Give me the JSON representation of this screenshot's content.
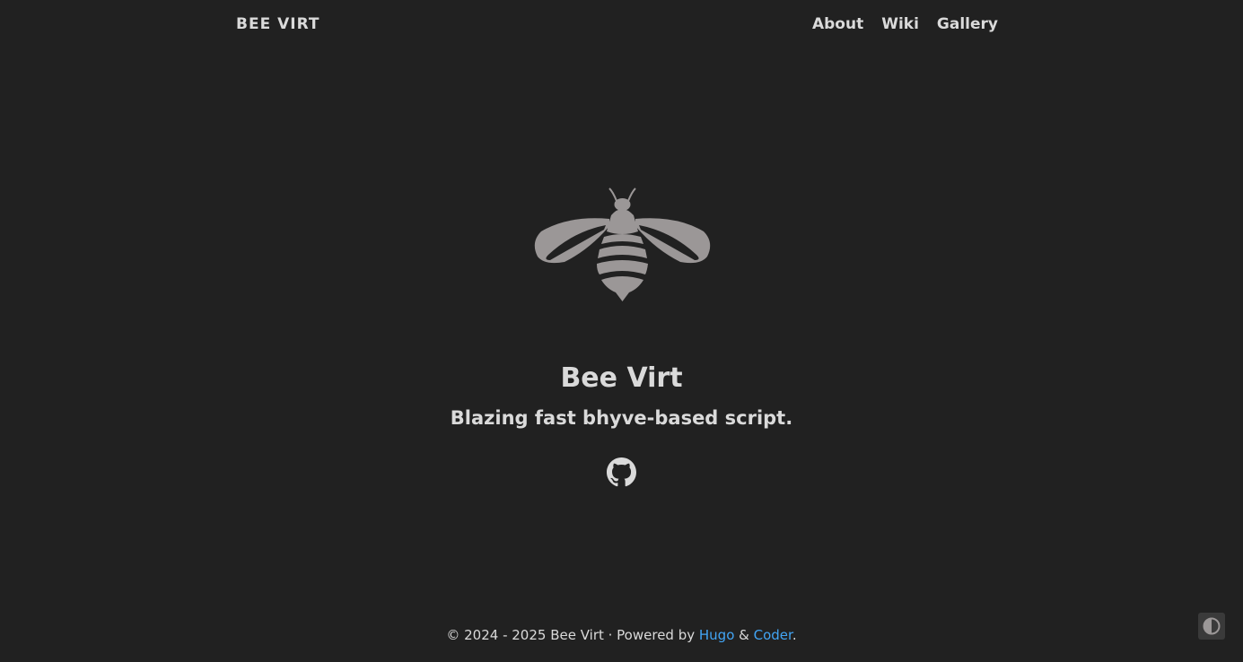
{
  "navbar": {
    "brand": "BEE VIRT",
    "links": [
      "About",
      "Wiki",
      "Gallery"
    ]
  },
  "hero": {
    "title": "Bee Virt",
    "subtitle": "Blazing fast bhyve-based script.",
    "avatar_icon": "bee-logo",
    "social_icon": "github-icon"
  },
  "footer": {
    "copyright": "© 2024 - 2025 Bee Virt · Powered by ",
    "hugo": "Hugo",
    "amp": " & ",
    "coder": "Coder",
    "end": "."
  },
  "colors": {
    "background": "#212121",
    "text": "#dadada",
    "link": "#42a5f5",
    "logo": "#9b9797"
  },
  "toggle": {
    "icon": "contrast-icon"
  }
}
